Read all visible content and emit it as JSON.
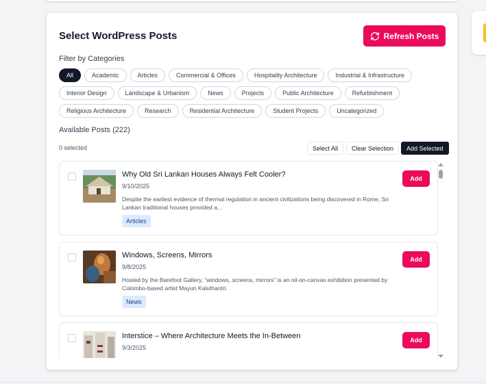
{
  "panel": {
    "title": "Select WordPress Posts",
    "refresh_label": "Refresh Posts",
    "filter_label": "Filter by Categories",
    "available_label": "Available Posts (222)",
    "selected_count": "0 selected",
    "select_all_label": "Select All",
    "clear_selection_label": "Clear Selection",
    "add_selected_label": "Add Selected"
  },
  "categories": [
    {
      "label": "All",
      "active": true
    },
    {
      "label": "Academic"
    },
    {
      "label": "Articles"
    },
    {
      "label": "Commercial & Offices"
    },
    {
      "label": "Hospitality Architecture"
    },
    {
      "label": "Industrial & Infrastructure"
    },
    {
      "label": "Interior Design"
    },
    {
      "label": "Landscape & Urbanism"
    },
    {
      "label": "News"
    },
    {
      "label": "Projects"
    },
    {
      "label": "Public Architecture"
    },
    {
      "label": "Refurbishment"
    },
    {
      "label": "Religious Architecture"
    },
    {
      "label": "Research"
    },
    {
      "label": "Residential Architecture"
    },
    {
      "label": "Student Projects"
    },
    {
      "label": "Uncategorized"
    }
  ],
  "posts": [
    {
      "title": "Why Old Sri Lankan Houses Always Felt Cooler?",
      "date": "9/10/2025",
      "excerpt": "Despite the earliest evidence of thermal regulation in ancient civilizations being discovered in Rome, Sri Lankan traditional houses provided a...",
      "tag": "Articles",
      "add_label": "Add"
    },
    {
      "title": "Windows, Screens, Mirrors",
      "date": "9/8/2025",
      "excerpt": "Hosted by the Barefoot Gallery, “windows, screens, mirrors” is an oil-on-canvas exhibition presented by Colombo-based artist Mayun Kaluthantri.",
      "tag": "News",
      "add_label": "Add"
    },
    {
      "title": "Interstice – Where Architecture Meets the In-Between",
      "date": "9/3/2025",
      "excerpt": "",
      "tag": "",
      "add_label": "Add"
    }
  ],
  "colors": {
    "accent": "#ec0b5b",
    "dark": "#111827",
    "tag_bg": "#dbeafe"
  }
}
